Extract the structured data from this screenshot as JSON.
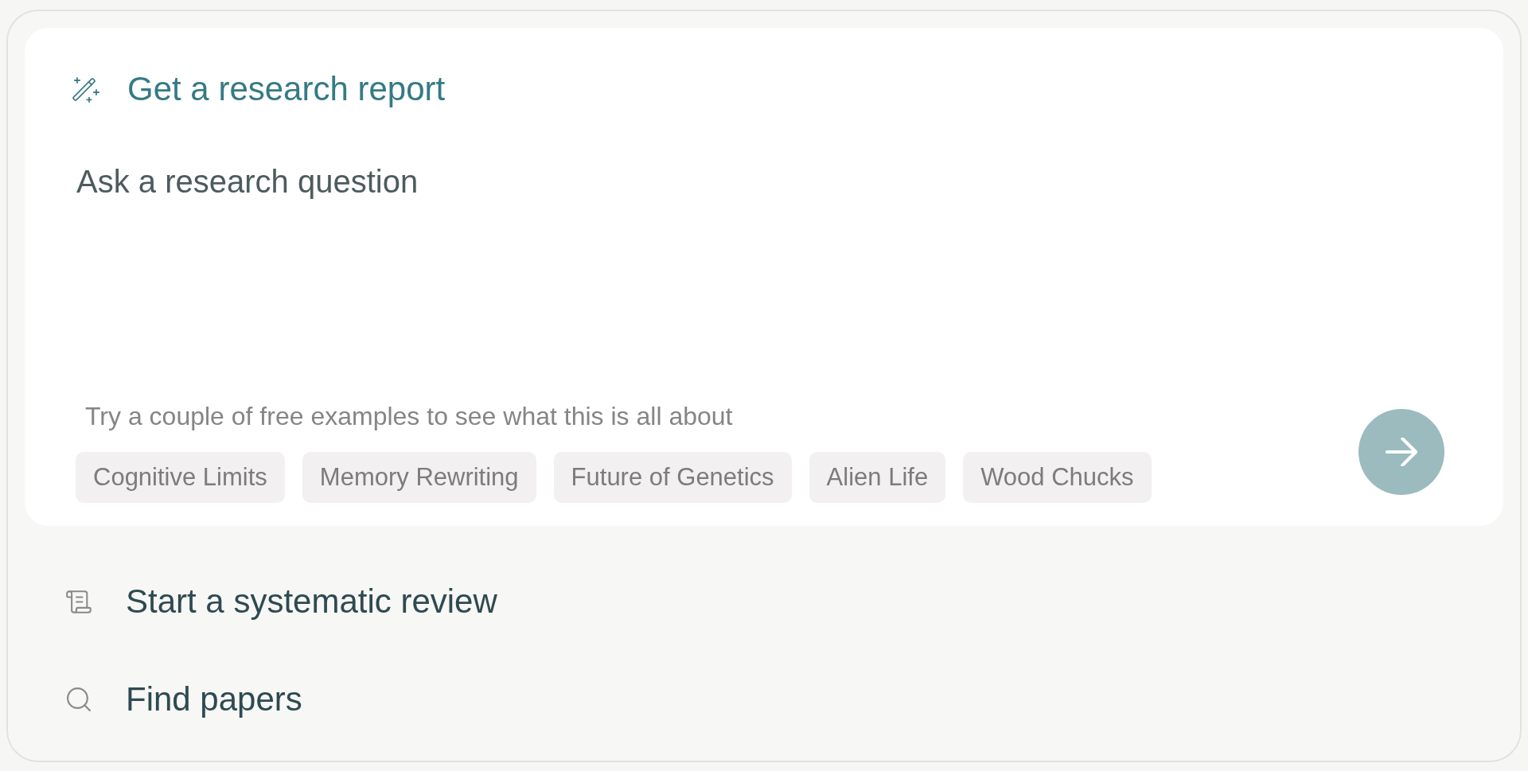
{
  "report": {
    "title": "Get a research report",
    "question": {
      "placeholder": "Ask a research question"
    },
    "examples_hint": "Try a couple of free examples to see what this is all about",
    "examples": [
      "Cognitive Limits",
      "Memory Rewriting",
      "Future of Genetics",
      "Alien Life",
      "Wood Chucks"
    ]
  },
  "options": [
    {
      "kind": "review",
      "label": "Start a systematic review"
    },
    {
      "kind": "search",
      "label": "Find papers"
    }
  ]
}
